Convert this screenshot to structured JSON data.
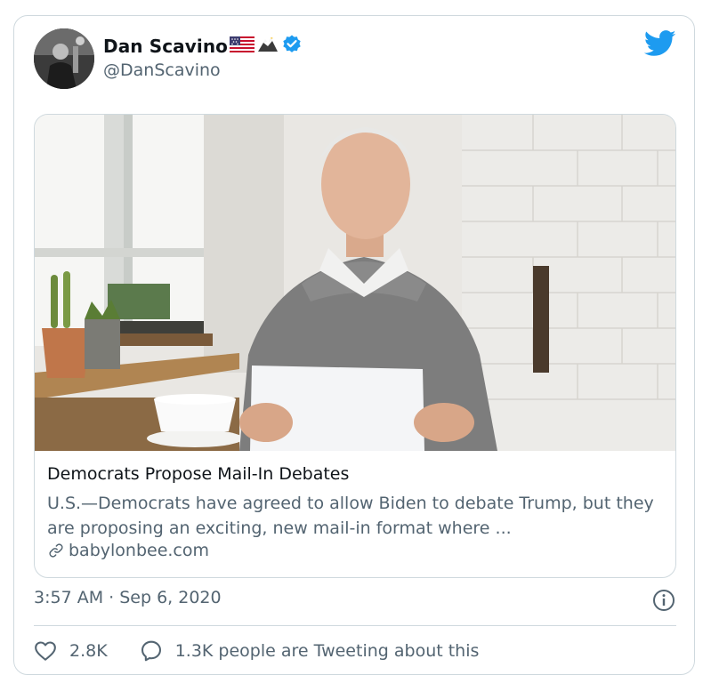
{
  "tweet": {
    "display_name": "Dan Scavino",
    "name_emojis": [
      "us-flag-emoji",
      "eagle-emoji",
      "verified-badge"
    ],
    "handle": "@DanScavino",
    "brand_icon": "twitter-bird-icon",
    "brand_color": "#1d9bf0",
    "timestamp": "3:57 AM · Sep 6, 2020",
    "info_icon": "info-icon"
  },
  "link_card": {
    "image_subject": "Joe Biden",
    "title": "Democrats Propose Mail-In Debates",
    "description": "U.S.—Democrats have agreed to allow Biden to debate Trump, but they are proposing an exciting, new mail-in format where ...",
    "domain": "babylonbee.com",
    "domain_icon": "link-icon"
  },
  "actions": {
    "likes": "2.8K",
    "like_icon": "heart-icon",
    "conversation": "1.3K people are Tweeting about this",
    "conversation_icon": "speech-bubble-icon"
  },
  "colors": {
    "text_primary": "#0f1419",
    "text_secondary": "#536471",
    "border": "#cfd9de",
    "verified": "#1d9bf0"
  }
}
